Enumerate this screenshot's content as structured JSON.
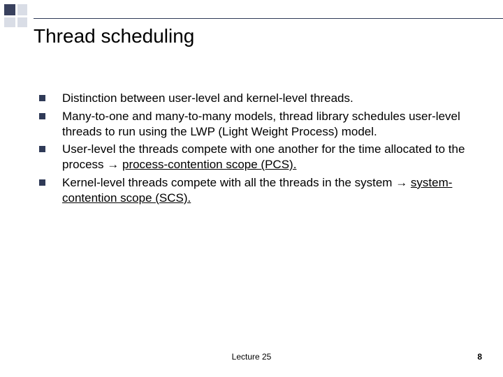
{
  "title": "Thread scheduling",
  "bullets": {
    "b0": {
      "text": "Distinction between user-level and kernel-level threads."
    },
    "b1": {
      "text": "Many-to-one and many-to-many models, thread library schedules user-level threads to run using the LWP (Light Weight Process) model."
    },
    "b2": {
      "pre": "User-level the threads  compete with one another for the time allocated to the process ",
      "arrow": "→ ",
      "underlined": "process-contention scope (PCS)."
    },
    "b3": {
      "pre": "Kernel-level threads compete with all the threads in the system ",
      "arrow": "→ ",
      "underlined": "system-contention scope (SCS)."
    }
  },
  "footer": {
    "lecture": "Lecture 25",
    "page": "8"
  }
}
